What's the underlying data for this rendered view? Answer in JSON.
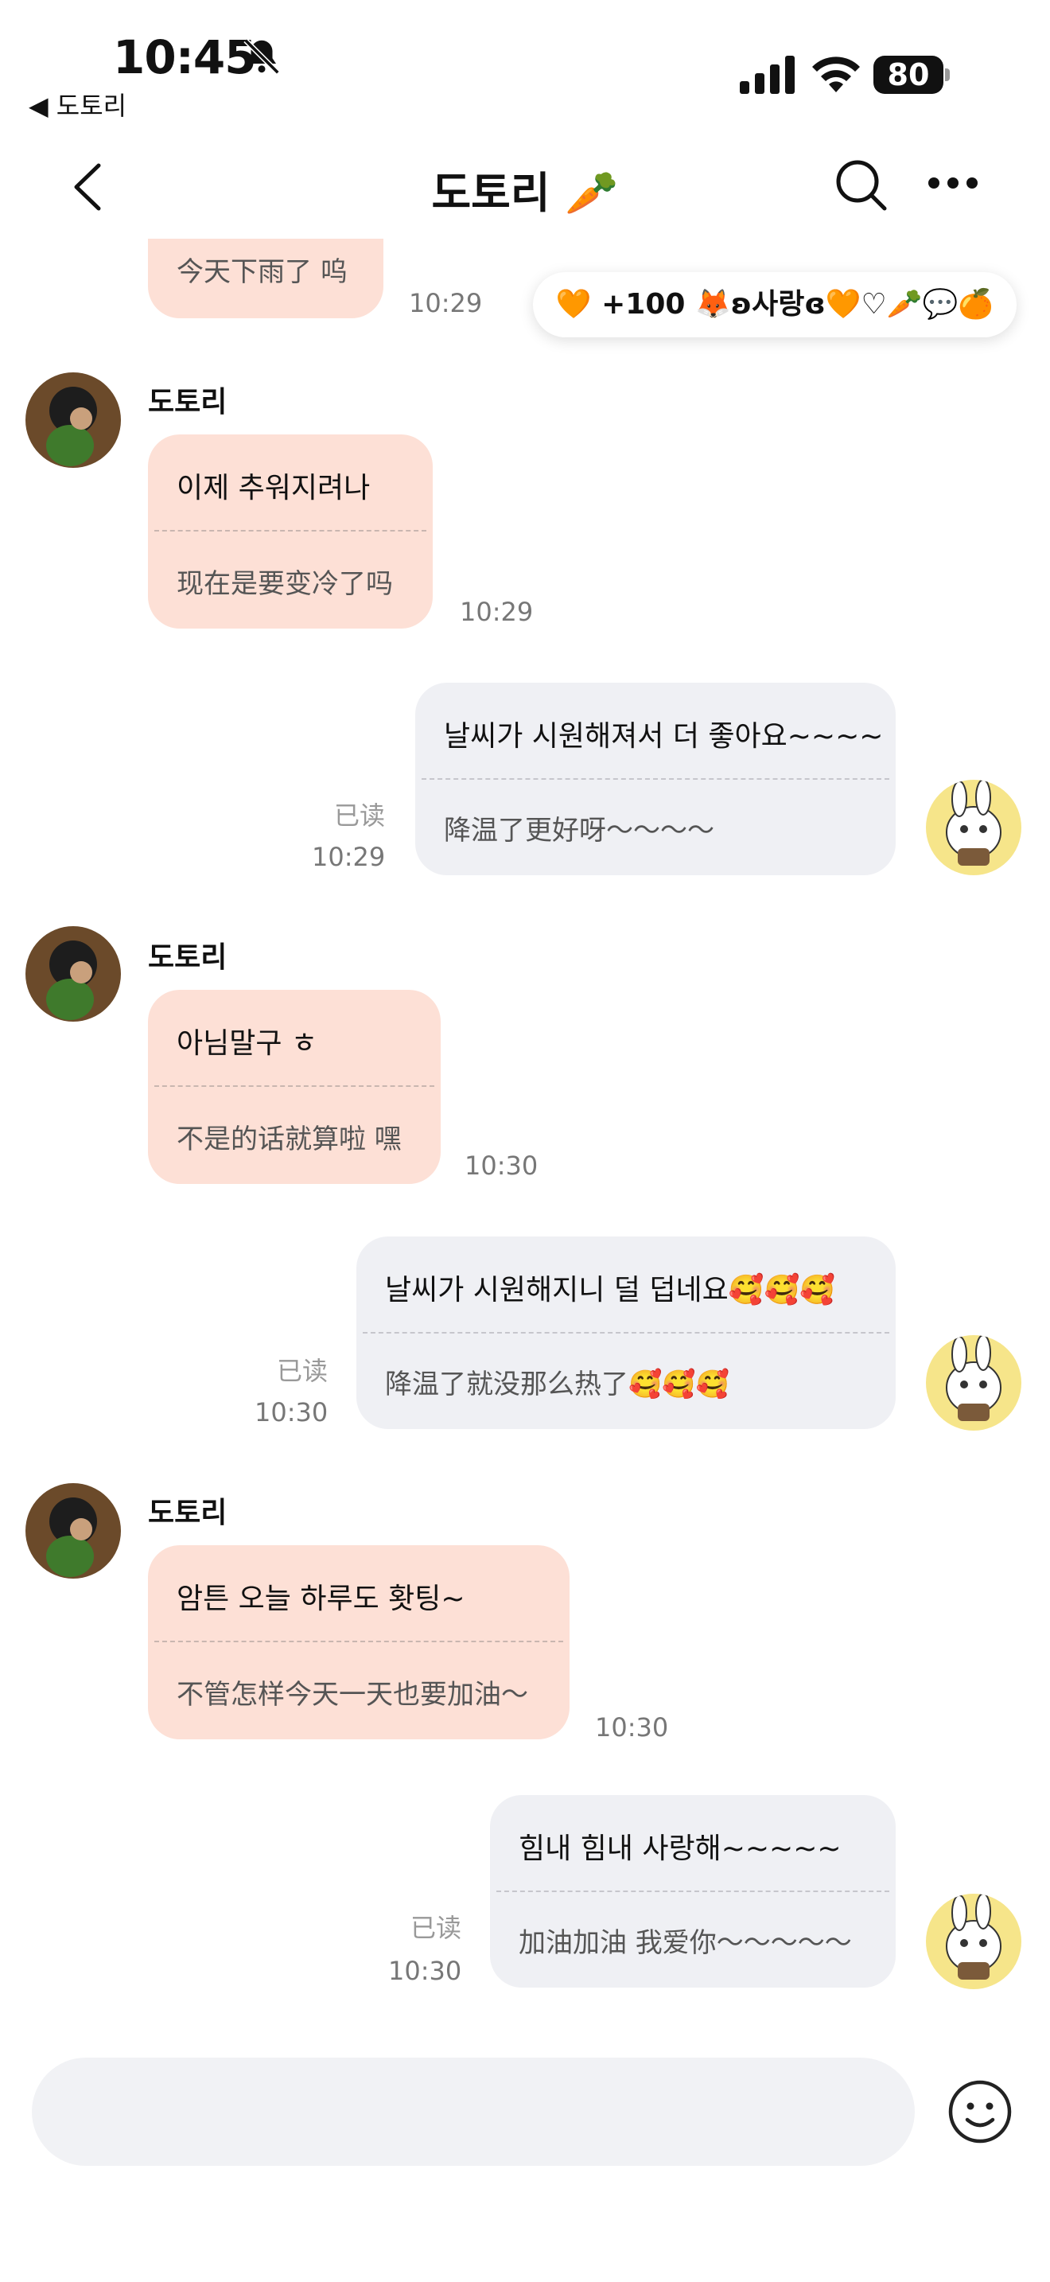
{
  "status_bar": {
    "time": "10:45",
    "back_app": "◀ 도토리",
    "battery": "80"
  },
  "nav": {
    "title": "도토리 🥕"
  },
  "reaction_strip": "🧡 +100 🦊ʚ사랑ɞ🧡♡🥕💬🍊",
  "messages": [
    {
      "side": "in",
      "line1": "今天下雨了 呜",
      "time": "10:29"
    },
    {
      "side": "in",
      "sender": "도토리",
      "line1": "이제 추워지려나",
      "line2": "现在是要变冷了吗",
      "time": "10:29"
    },
    {
      "side": "out",
      "line1": "날씨가 시원해져서 더 좋아요~~~~",
      "line2": "降温了更好呀～～～～",
      "read": "已读",
      "time": "10:29"
    },
    {
      "side": "in",
      "sender": "도토리",
      "line1": "아님말구 ㅎ",
      "line2": "不是的话就算啦 嘿",
      "time": "10:30"
    },
    {
      "side": "out",
      "line1": "날씨가 시원해지니 덜 덥네요🥰🥰🥰",
      "line2": "降温了就没那么热了🥰🥰🥰",
      "read": "已读",
      "time": "10:30"
    },
    {
      "side": "in",
      "sender": "도토리",
      "line1": "암튼 오늘 하루도 홧팅~",
      "line2": "不管怎样今天一天也要加油～",
      "time": "10:30"
    },
    {
      "side": "out",
      "line1": "힘내 힘내 사랑해~~~~~",
      "line2": "加油加油 我爱你～～～～～",
      "read": "已读",
      "time": "10:30"
    }
  ],
  "input": {
    "value": "",
    "placeholder": ""
  },
  "colors": {
    "incoming_bubble": "#fde0d6",
    "outgoing_bubble": "#eff0f4"
  }
}
